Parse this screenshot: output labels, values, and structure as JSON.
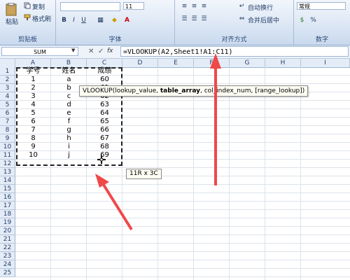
{
  "ribbon": {
    "clipboard": {
      "paste": "粘贴",
      "copy": "复制",
      "format_painter": "格式刷",
      "group_label": "剪贴板"
    },
    "font": {
      "group_label": "字体",
      "size": "11"
    },
    "alignment": {
      "wrap_text": "自动换行",
      "merge_center": "合并后居中",
      "group_label": "对齐方式"
    },
    "number": {
      "format": "常规",
      "group_label": "数字"
    }
  },
  "formula_bar": {
    "name_box": "SUM",
    "cancel": "✕",
    "enter": "✓",
    "fx": "fx",
    "formula": "=VLOOKUP(A2,Sheet1!A1:C11)"
  },
  "columns": [
    "A",
    "B",
    "C",
    "D",
    "E",
    "F",
    "G",
    "H",
    "I"
  ],
  "rows": [
    "1",
    "2",
    "3",
    "4",
    "5",
    "6",
    "7",
    "8",
    "9",
    "10",
    "11",
    "12",
    "13",
    "14",
    "15",
    "16",
    "17",
    "18",
    "19",
    "20",
    "21",
    "22",
    "23",
    "24",
    "25"
  ],
  "table": {
    "headers": [
      "学号",
      "姓名",
      "成绩"
    ],
    "data": [
      [
        "1",
        "a",
        "60"
      ],
      [
        "2",
        "b",
        "61"
      ],
      [
        "3",
        "c",
        "62"
      ],
      [
        "4",
        "d",
        "63"
      ],
      [
        "5",
        "e",
        "64"
      ],
      [
        "6",
        "f",
        "65"
      ],
      [
        "7",
        "g",
        "66"
      ],
      [
        "8",
        "h",
        "67"
      ],
      [
        "9",
        "i",
        "68"
      ],
      [
        "10",
        "j",
        "69"
      ]
    ]
  },
  "tooltip": {
    "pre": "VLOOKUP(lookup_value, ",
    "bold": "table_array",
    "post": ", col_index_num, [range_lookup])"
  },
  "size_tip": "11R x 3C",
  "colors": {
    "arrow": "#f04848",
    "ribbon_bg": "#dbe6f4"
  }
}
